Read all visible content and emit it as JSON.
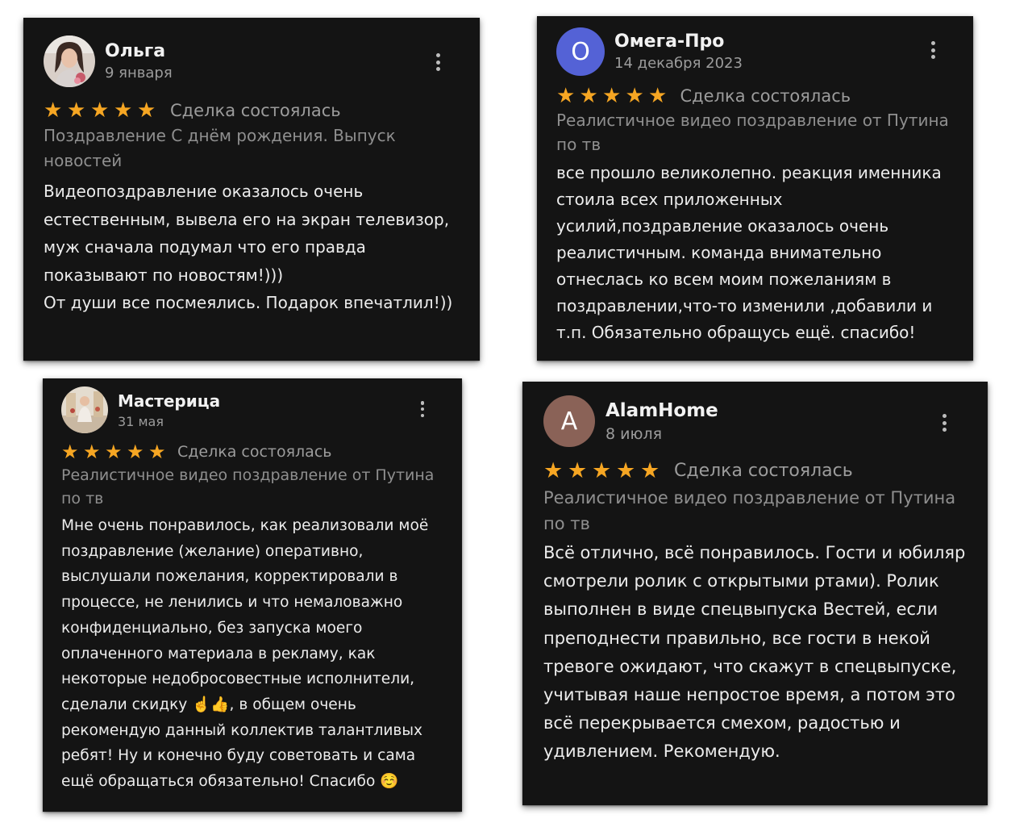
{
  "colors": {
    "card_background": "#141414",
    "star": "#f6a623",
    "avatar_omega": "#5462d6",
    "avatar_alamhome": "#8a6257"
  },
  "reviews": [
    {
      "author": "Ольга",
      "date": "9 января",
      "avatar": "photo",
      "rating": 5,
      "status": "Сделка состоялась",
      "product": "Поздравление С днём рождения. Выпуск новостей",
      "text": "Видеопоздравление оказалось очень естественным, вывела его на экран телевизор, муж сначала подумал что его правда показывают по новостям!)))\nОт души все посмеялись. Подарок впечатлил!))"
    },
    {
      "author": "Омега-Про",
      "date": "14 декабря 2023",
      "avatar": "О",
      "rating": 5,
      "status": "Сделка состоялась",
      "product": "Реалистичное видео поздравление от Путина по тв",
      "text": "все прошло великолепно. реакция именника стоила всех приложенных усилий,поздравление оказалось очень реалистичным. команда внимательно отнеслась ко всем моим пожеланиям в поздравлении,что-то изменили ,добавили и т.п. Обязательно обращусь ещё. спасибо!"
    },
    {
      "author": "Мастерица",
      "date": "31 мая",
      "avatar": "photo",
      "rating": 5,
      "status": "Сделка состоялась",
      "product": "Реалистичное видео поздравление от Путина по тв",
      "text": "Мне очень понравилось, как реализовали моё поздравление (желание) оперативно, выслушали пожелания, корректировали в процессе, не ленились и что немаловажно конфиденциально, без запуска моего оплаченного материала в рекламу, как некоторые недобросовестные исполнители, сделали скидку ☝️👍, в общем очень рекомендую данный коллектив талантливых ребят! Ну и конечно буду советовать и сама ещё обращаться обязательно! Спасибо ☺️"
    },
    {
      "author": "AlamHome",
      "date": "8 июля",
      "avatar": "А",
      "rating": 5,
      "status": "Сделка состоялась",
      "product": "Реалистичное видео поздравление от Путина по тв",
      "text": "Всё отлично, всё понравилось. Гости и юбиляр смотрели ролик с открытыми ртами). Ролик выполнен в виде спецвыпуска Вестей, если преподнести правильно, все гости в некой тревоге ожидают, что скажут в спецвыпуске, учитывая наше непростое время, а потом это всё перекрывается смехом, радостью и удивлением. Рекомендую."
    }
  ]
}
